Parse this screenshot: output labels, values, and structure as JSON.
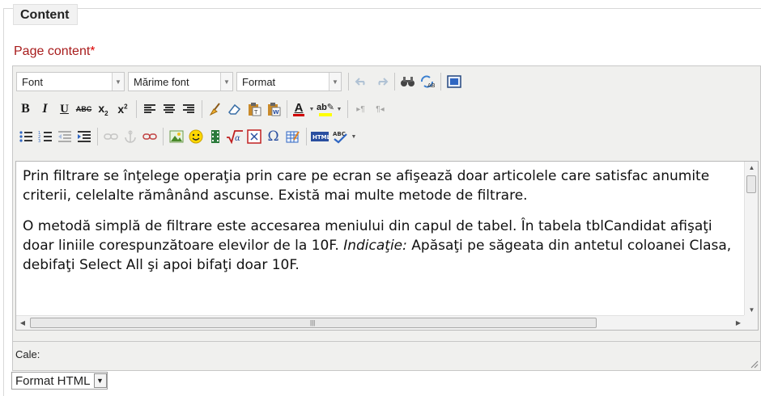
{
  "section": {
    "legend": "Content"
  },
  "field": {
    "label": "Page content",
    "required_marker": "*"
  },
  "toolbar": {
    "font_select": "Font",
    "size_select": "Mărime font",
    "format_select": "Format"
  },
  "icons": {
    "undo": "undo-icon",
    "redo": "redo-icon",
    "find": "find-icon",
    "replace": "replace-icon",
    "fullscreen": "fullscreen-icon",
    "bold": "bold-icon",
    "italic": "italic-icon",
    "underline": "underline-icon",
    "strikethrough": "strikethrough-icon",
    "subscript": "subscript-icon",
    "superscript": "superscript-icon"
  },
  "editor": {
    "paragraphs": [
      {
        "text": "Prin filtrare se înţelege operaţia prin care pe ecran se afişează doar articolele care satisfac anumite criterii, celelalte rămânând ascunse. Există mai multe metode de filtrare."
      },
      {
        "before": "O metodă simplă de filtrare este accesarea meniului din capul de tabel. În tabela tblCandidat afişaţi doar liniile corespunzătoare elevilor de la 10F. ",
        "italic": "Indicaţie:",
        "after": " Apăsaţi pe săgeata din antetul coloanei Clasa, debifaţi Select All şi apoi bifaţi doar 10F."
      }
    ]
  },
  "status": {
    "path_label": "Cale:"
  },
  "format_select": {
    "value": "Format HTML"
  },
  "colors": {
    "label_red": "#a81c1c",
    "required_red": "#dd0000",
    "toolbar_bg": "#f0f0ee",
    "text_color_bar": "#d00000",
    "highlight_bar": "#ffff00"
  }
}
